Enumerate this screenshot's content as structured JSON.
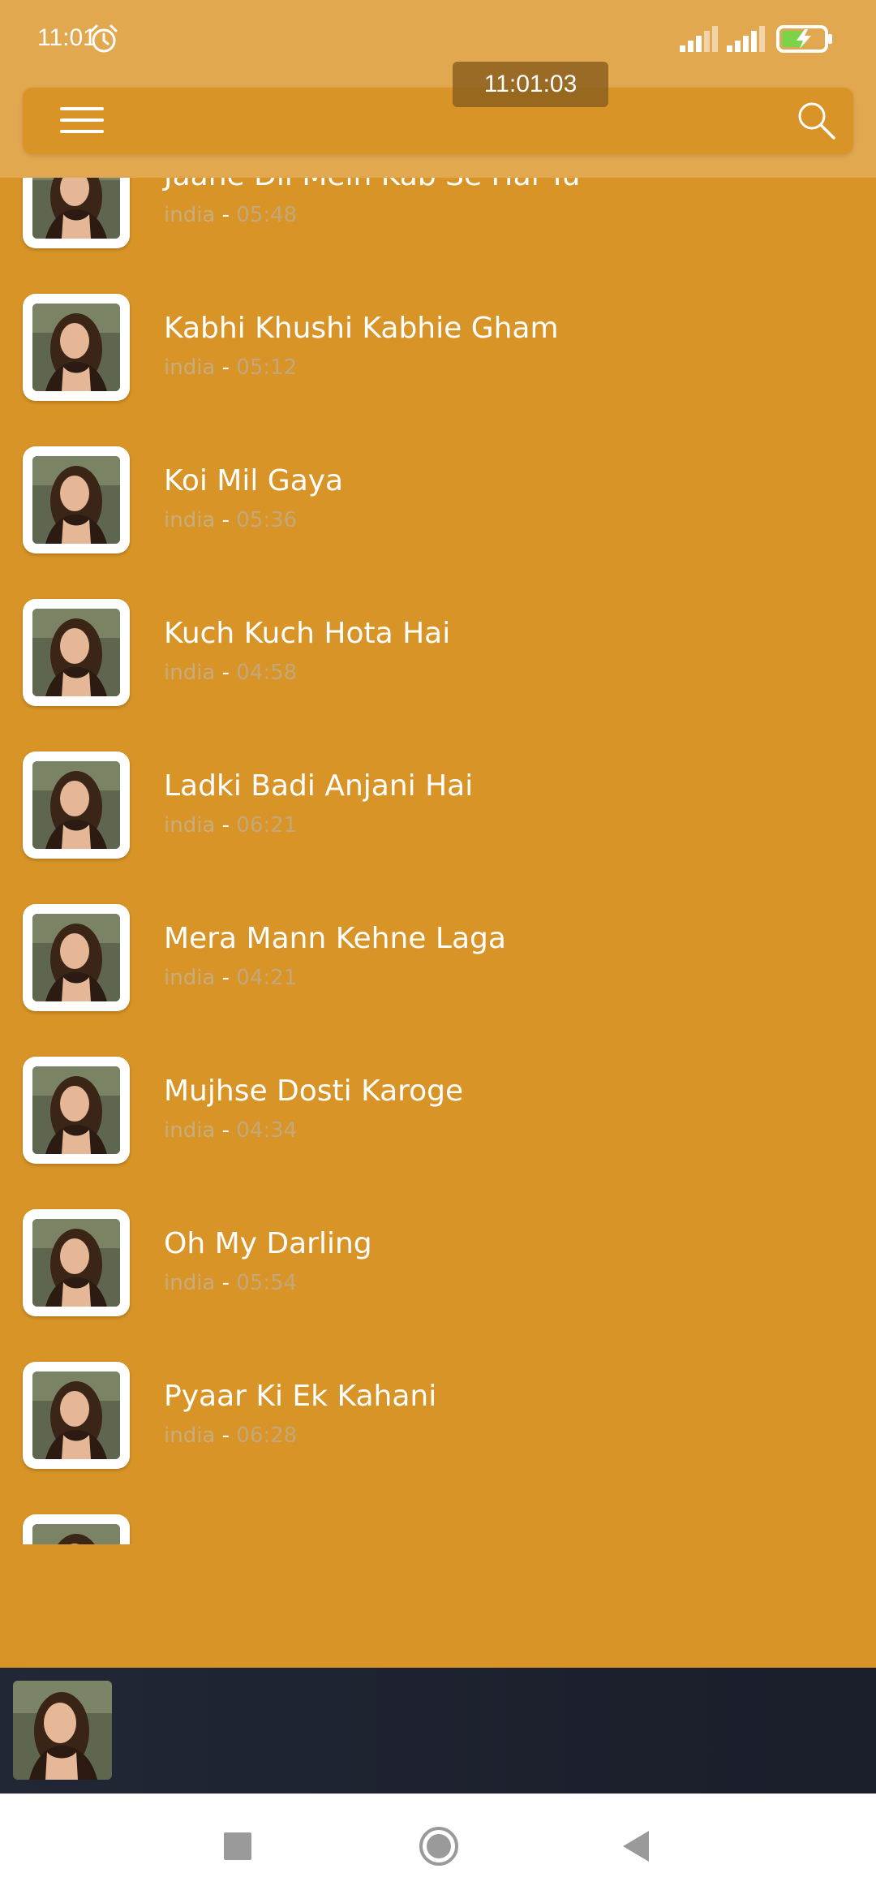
{
  "status_bar": {
    "time": "11:01",
    "icons": [
      "alarm-icon",
      "signal-icon",
      "signal-icon",
      "battery-charging-icon"
    ]
  },
  "toast": {
    "time": "11:01:03"
  },
  "toolbar": {
    "menu_icon": "hamburger-menu-icon",
    "search_icon": "search-icon"
  },
  "songs": [
    {
      "title": "Jaane Dil Mein Kab Se Hai Tu",
      "artist": "india",
      "separator": " - ",
      "duration": "05:48"
    },
    {
      "title": "Kabhi Khushi Kabhie Gham",
      "artist": "india",
      "separator": " - ",
      "duration": "05:12"
    },
    {
      "title": "Koi Mil Gaya",
      "artist": "india",
      "separator": " - ",
      "duration": "05:36"
    },
    {
      "title": "Kuch Kuch Hota Hai",
      "artist": "india",
      "separator": " - ",
      "duration": "04:58"
    },
    {
      "title": "Ladki Badi Anjani Hai",
      "artist": "india",
      "separator": " - ",
      "duration": "06:21"
    },
    {
      "title": "Mera Mann Kehne Laga",
      "artist": "india",
      "separator": " - ",
      "duration": "04:21"
    },
    {
      "title": "Mujhse Dosti Karoge",
      "artist": "india",
      "separator": " - ",
      "duration": "04:34"
    },
    {
      "title": "Oh My Darling",
      "artist": "india",
      "separator": " - ",
      "duration": "05:54"
    },
    {
      "title": "Pyaar Ki Ek Kahani",
      "artist": "india",
      "separator": " - ",
      "duration": "06:28"
    }
  ],
  "colors": {
    "background": "#D89426",
    "header": "#E2A850",
    "player": "#212735",
    "artist_text": "#C8AC7E"
  },
  "nav_bar": {
    "icons": [
      "recents-icon",
      "home-icon",
      "back-icon"
    ]
  }
}
